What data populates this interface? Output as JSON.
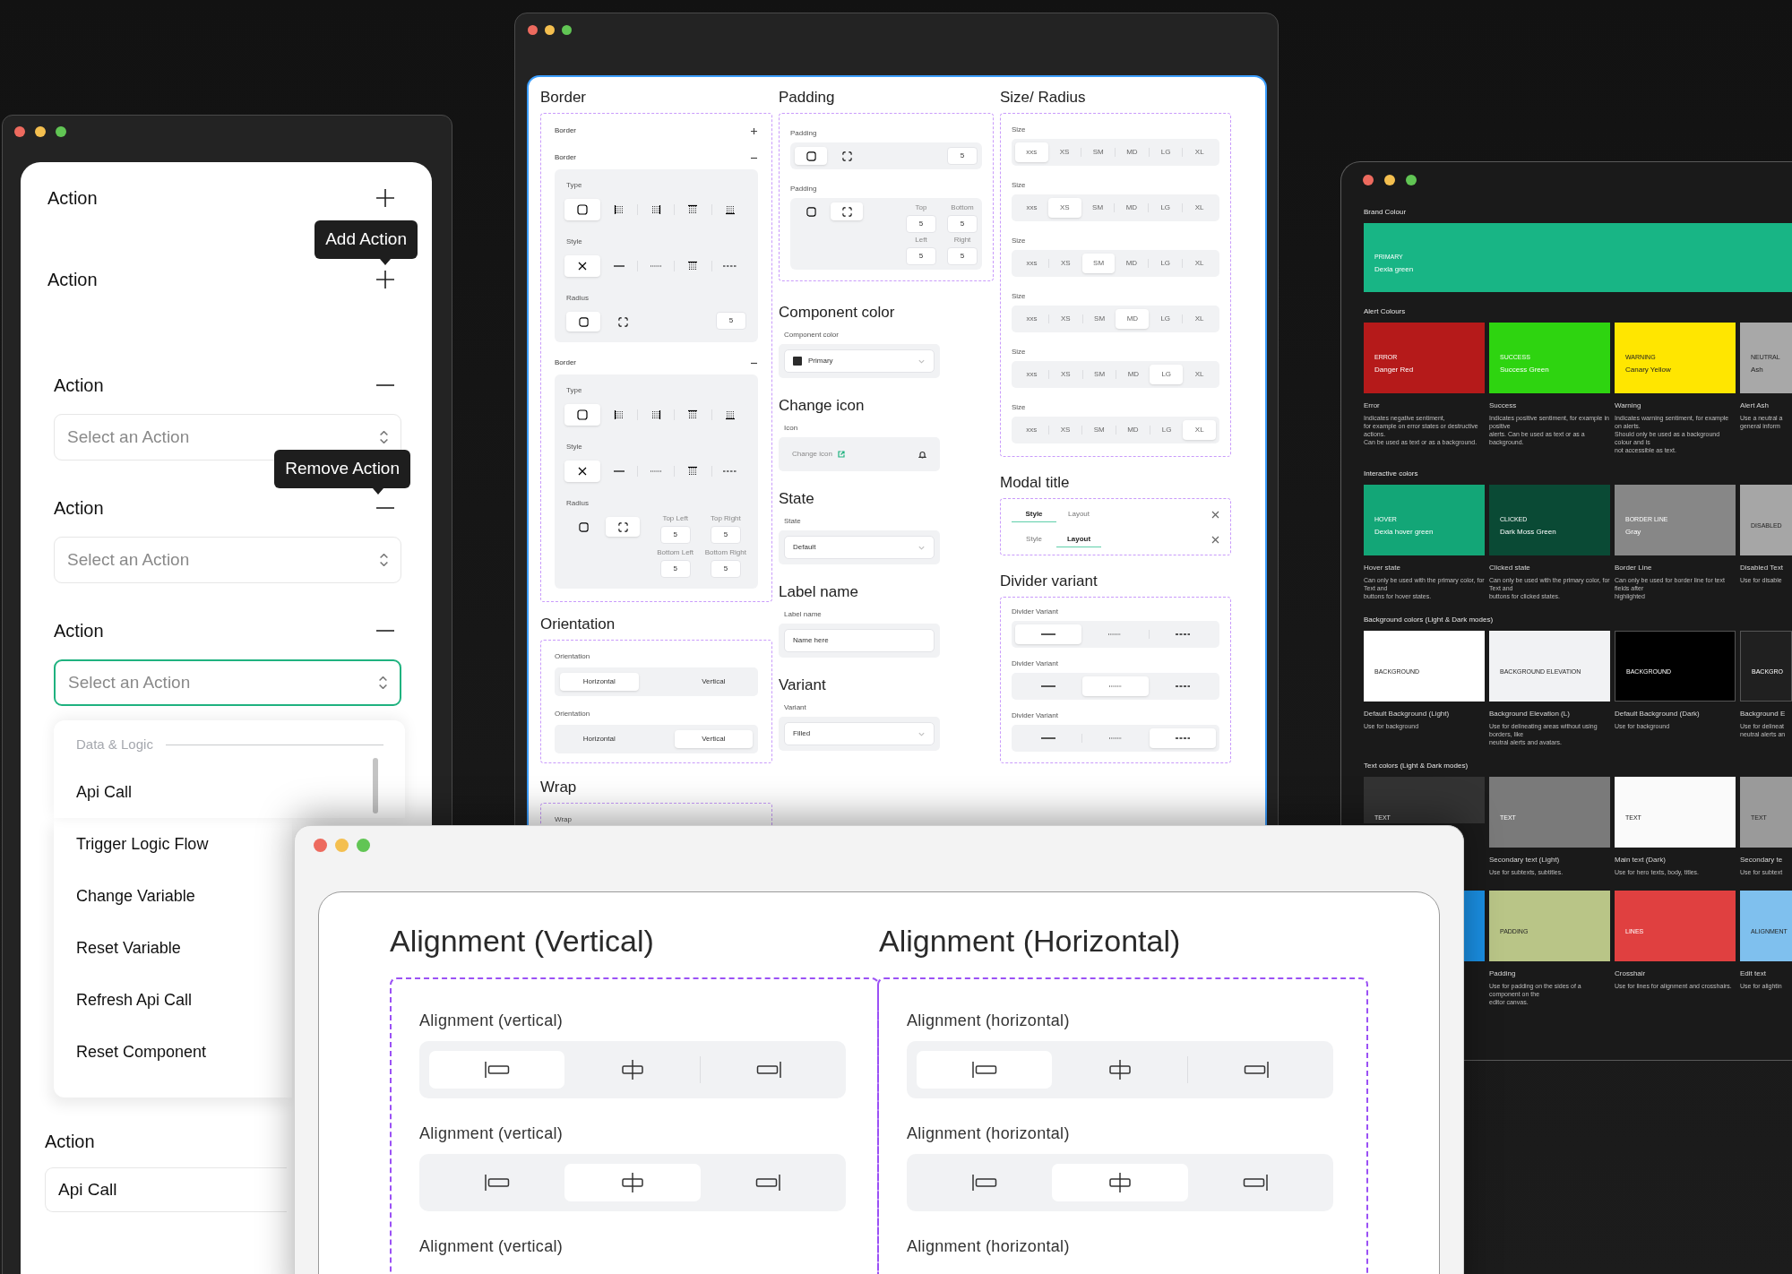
{
  "action_panel": {
    "rows": [
      {
        "label": "Action",
        "kind": "add"
      },
      {
        "label": "Action",
        "kind": "add",
        "tooltip": "Add Action"
      },
      {
        "label": "Action",
        "kind": "remove",
        "placeholder": "Select an Action",
        "focused": false
      },
      {
        "label": "Action",
        "kind": "remove",
        "tooltip": "Remove Action",
        "placeholder": "Select an Action",
        "focused": false
      },
      {
        "label": "Action",
        "kind": "remove",
        "placeholder": "Select an Action",
        "focused": true
      }
    ],
    "menu": {
      "group": "Data & Logic",
      "items": [
        "Api Call",
        "Trigger Logic Flow",
        "Change Variable",
        "Reset Variable",
        "Refresh Api Call",
        "Reset Component"
      ]
    },
    "final": {
      "label": "Action",
      "value": "Api Call"
    }
  },
  "properties": {
    "border": {
      "title": "Border",
      "groups": [
        {
          "label": "Border",
          "expanded": false
        },
        {
          "label": "Border",
          "expanded": true,
          "type_label": "Type",
          "type": [
            {
              "selected": true
            },
            {
              "selected": false
            },
            {
              "selected": false
            },
            {
              "selected": false
            },
            {
              "selected": false
            }
          ],
          "style_label": "Style",
          "style": [
            {
              "selected": true
            },
            {
              "selected": false
            },
            {
              "selected": false
            },
            {
              "selected": false
            },
            {
              "selected": false
            }
          ],
          "radius_label": "Radius",
          "radius": [
            {
              "selected": true
            },
            {
              "selected": false
            }
          ],
          "value": "5"
        },
        {
          "label": "Border",
          "expanded": true,
          "type_label": "Type",
          "type": [
            {
              "selected": true
            },
            {
              "selected": false
            },
            {
              "selected": false
            },
            {
              "selected": false
            },
            {
              "selected": false
            }
          ],
          "style_label": "Style",
          "style": [
            {
              "selected": true
            },
            {
              "selected": false
            },
            {
              "selected": false
            },
            {
              "selected": false
            },
            {
              "selected": false
            }
          ],
          "radius_label": "Radius",
          "radius": [
            {
              "selected": false
            },
            {
              "selected": true
            }
          ],
          "corners": [
            {
              "label": "Top Left",
              "value": "5"
            },
            {
              "label": "Top Right",
              "value": "5"
            },
            {
              "label": "Bottom Left",
              "value": "5"
            },
            {
              "label": "Bottom Right",
              "value": "5"
            }
          ]
        }
      ]
    },
    "orientation": {
      "title": "Orientation",
      "rows": [
        {
          "label": "Orientation",
          "options": [
            {
              "label": "Horizontal",
              "selected": true
            },
            {
              "label": "Vertical",
              "selected": false
            }
          ]
        },
        {
          "label": "Orientation",
          "options": [
            {
              "label": "Horizontal",
              "selected": false
            },
            {
              "label": "Vertical",
              "selected": true
            }
          ]
        }
      ]
    },
    "wrap": {
      "title": "Wrap",
      "label": "Wrap"
    },
    "padding": {
      "title": "Padding",
      "items": [
        {
          "label": "Padding",
          "modes": [
            {
              "selected": true
            },
            {
              "selected": false
            }
          ],
          "value": "5"
        },
        {
          "label": "Padding",
          "modes": [
            {
              "selected": false
            },
            {
              "selected": true
            }
          ],
          "sides": [
            {
              "label": "Top",
              "value": "5"
            },
            {
              "label": "Bottom",
              "value": "5"
            },
            {
              "label": "Left",
              "value": "5"
            },
            {
              "label": "Right",
              "value": "5"
            }
          ]
        }
      ]
    },
    "fields": [
      {
        "kind": "color",
        "title": "Component color",
        "label": "Component color",
        "value": "Primary"
      },
      {
        "kind": "icon",
        "title": "Change icon",
        "label": "Icon",
        "placeholder": "Change icon"
      },
      {
        "kind": "select",
        "title": "State",
        "label": "State",
        "value": "Default"
      },
      {
        "kind": "text",
        "title": "Label name",
        "label": "Label name",
        "value": "Name here"
      },
      {
        "kind": "select",
        "title": "Variant",
        "label": "Variant",
        "value": "Filled"
      }
    ],
    "size": {
      "title": "Size/ Radius",
      "rows": [
        {
          "label": "Size",
          "options": [
            {
              "label": "xxs",
              "selected": true
            },
            {
              "label": "XS",
              "selected": false
            },
            {
              "label": "SM",
              "selected": false
            },
            {
              "label": "MD",
              "selected": false
            },
            {
              "label": "LG",
              "selected": false
            },
            {
              "label": "XL",
              "selected": false
            }
          ]
        },
        {
          "label": "Size",
          "options": [
            {
              "label": "xxs",
              "selected": false
            },
            {
              "label": "XS",
              "selected": true
            },
            {
              "label": "SM",
              "selected": false
            },
            {
              "label": "MD",
              "selected": false
            },
            {
              "label": "LG",
              "selected": false
            },
            {
              "label": "XL",
              "selected": false
            }
          ]
        },
        {
          "label": "Size",
          "options": [
            {
              "label": "xxs",
              "selected": false
            },
            {
              "label": "XS",
              "selected": false
            },
            {
              "label": "SM",
              "selected": true
            },
            {
              "label": "MD",
              "selected": false
            },
            {
              "label": "LG",
              "selected": false
            },
            {
              "label": "XL",
              "selected": false
            }
          ]
        },
        {
          "label": "Size",
          "options": [
            {
              "label": "xxs",
              "selected": false
            },
            {
              "label": "XS",
              "selected": false
            },
            {
              "label": "SM",
              "selected": false
            },
            {
              "label": "MD",
              "selected": true
            },
            {
              "label": "LG",
              "selected": false
            },
            {
              "label": "XL",
              "selected": false
            }
          ]
        },
        {
          "label": "Size",
          "options": [
            {
              "label": "xxs",
              "selected": false
            },
            {
              "label": "XS",
              "selected": false
            },
            {
              "label": "SM",
              "selected": false
            },
            {
              "label": "MD",
              "selected": false
            },
            {
              "label": "LG",
              "selected": true
            },
            {
              "label": "XL",
              "selected": false
            }
          ]
        },
        {
          "label": "Size",
          "options": [
            {
              "label": "xxs",
              "selected": false
            },
            {
              "label": "XS",
              "selected": false
            },
            {
              "label": "SM",
              "selected": false
            },
            {
              "label": "MD",
              "selected": false
            },
            {
              "label": "LG",
              "selected": false
            },
            {
              "label": "XL",
              "selected": true
            }
          ]
        }
      ]
    },
    "modal": {
      "title": "Modal title",
      "rows": [
        {
          "tabs": [
            {
              "label": "Style",
              "selected": true
            },
            {
              "label": "Layout",
              "selected": false
            }
          ]
        },
        {
          "tabs": [
            {
              "label": "Style",
              "selected": false
            },
            {
              "label": "Layout",
              "selected": true
            }
          ]
        }
      ]
    },
    "divider": {
      "title": "Divider variant",
      "rows": [
        {
          "label": "Divider Variant",
          "options": [
            {
              "selected": true
            },
            {
              "selected": false
            },
            {
              "selected": false
            }
          ]
        },
        {
          "label": "Divider Variant",
          "options": [
            {
              "selected": false
            },
            {
              "selected": true
            },
            {
              "selected": false
            }
          ]
        },
        {
          "label": "Divider Variant",
          "options": [
            {
              "selected": false
            },
            {
              "selected": false
            },
            {
              "selected": true
            }
          ]
        }
      ]
    }
  },
  "colors": {
    "sections": [
      {
        "title": "Brand Colour",
        "kind": "banner",
        "swatches": [
          {
            "category": "PRIMARY",
            "name": "Dexla green",
            "color": "#18b585"
          }
        ]
      },
      {
        "title": "Alert Colours",
        "swatches": [
          {
            "category": "ERROR",
            "name": "Danger Red",
            "color": "#b51a1a",
            "title": "Error",
            "description": "Indicates negative sentiment,\nfor example on error states or destructive actions.\nCan be used as text or as a background."
          },
          {
            "category": "SUCCESS",
            "name": "Success Green",
            "color": "#2ed410",
            "title": "Success",
            "description": "Indicates positive sentiment, for example in positive\nalerts. Can be used as text or as a background."
          },
          {
            "category": "WARNING",
            "name": "Canary Yellow",
            "color": "#ffe600",
            "title": "Warning",
            "description": "Indicates warning sentiment, for example on alerts.\nShould only be used as a background colour and is\nnot accessible as text."
          },
          {
            "category": "NEUTRAL",
            "name": "Ash",
            "color": "#a8a8a8",
            "title": "Alert Ash",
            "description": "Use a neutral a\ngeneral inform"
          }
        ]
      },
      {
        "title": "Interactive colors",
        "swatches": [
          {
            "category": "HOVER",
            "name": "Dexla hover green",
            "color": "#13a677",
            "title": "Hover state",
            "description": "Can only be used with the primary color, for Text and\nbuttons for hover states."
          },
          {
            "category": "CLICKED",
            "name": "Dark Moss Green",
            "color": "#0a4a35",
            "title": "Clicked state",
            "description": "Can only be used with the primary color, for Text and\nbuttons for clicked states."
          },
          {
            "category": "BORDER LINE",
            "name": "Gray",
            "color": "#878787",
            "title": "Border Line",
            "description": "Can only be used for border line for text fields after\nhighlighted"
          },
          {
            "category": "DISABLED",
            "color": "#a6a6a6",
            "title": "Disabled Text",
            "description": "Use for disable"
          }
        ]
      },
      {
        "title": "Background colors (Light & Dark modes)",
        "swatches": [
          {
            "category": "BACKGROUND",
            "color": "#ffffff",
            "title": "Default Background (Light)",
            "description": "Use for background"
          },
          {
            "category": "BACKGROUND ELEVATION",
            "color": "#f1f2f4",
            "title": "Background Elevation (L)",
            "description": "Use for delineating areas without using borders, like\nneutral alerts and avatars."
          },
          {
            "category": "BACKGROUND",
            "color": "#000000",
            "title": "Default Background (Dark)",
            "description": "Use for background"
          },
          {
            "category": "BACKGRO",
            "color": "#202020",
            "title": "Background E",
            "description": "Use for delineat\nneutral alerts an"
          }
        ]
      },
      {
        "title": "Text colors (Light & Dark modes)",
        "swatches": [
          {
            "category": "TEXT",
            "color": "#333333"
          },
          {
            "category": "TEXT",
            "color": "#7a7a7a",
            "title": "Secondary text (Light)",
            "description": "Use for subtexts, subtitles."
          },
          {
            "category": "TEXT",
            "color": "#fafafa",
            "title": "Main text (Dark)",
            "description": "Use for hero texts, body, titles."
          },
          {
            "category": "TEXT",
            "color": "#9a9a9a",
            "title": "Secondary te",
            "description": "Use for subtext"
          }
        ]
      },
      {
        "swatches": [
          {
            "color": "#1a8fe3"
          },
          {
            "category": "PADDING",
            "color": "#b9c587",
            "title": "Padding",
            "description": "Use for padding on the sides of a component on the\neditor canvas."
          },
          {
            "category": "LINES",
            "color": "#e04040",
            "title": "Crosshair",
            "description": "Use for lines for alignment and crosshairs."
          },
          {
            "category": "ALIGNMENT",
            "color": "#7fc0ee",
            "title": "Edit text",
            "description": "Use for alightin"
          }
        ]
      }
    ]
  },
  "alignment": {
    "columns": [
      {
        "title": "Alignment (Vertical)",
        "rows": [
          {
            "label": "Alignment (vertical)",
            "options": [
              {
                "selected": true
              },
              {
                "selected": false
              },
              {
                "selected": false
              }
            ]
          },
          {
            "label": "Alignment (vertical)",
            "options": [
              {
                "selected": false
              },
              {
                "selected": true
              },
              {
                "selected": false
              }
            ]
          },
          {
            "label": "Alignment (vertical)"
          }
        ]
      },
      {
        "title": "Alignment (Horizontal)",
        "rows": [
          {
            "label": "Alignment (horizontal)",
            "options": [
              {
                "selected": true
              },
              {
                "selected": false
              },
              {
                "selected": false
              }
            ]
          },
          {
            "label": "Alignment (horizontal)",
            "options": [
              {
                "selected": false
              },
              {
                "selected": true
              },
              {
                "selected": false
              }
            ]
          },
          {
            "label": "Alignment (horizontal)"
          }
        ]
      }
    ]
  }
}
